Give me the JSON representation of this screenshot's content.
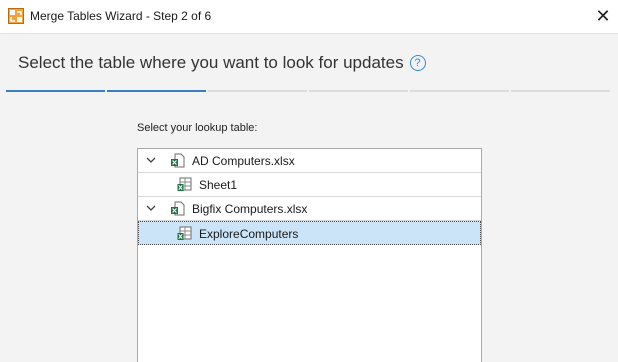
{
  "window": {
    "title": "Merge Tables Wizard - Step 2 of 6"
  },
  "header": {
    "text": "Select the table where you want to look for updates"
  },
  "steps": {
    "total": 6,
    "current": 2
  },
  "lookup": {
    "label": "Select your lookup table:",
    "tree": [
      {
        "label": "AD Computers.xlsx",
        "type": "workbook",
        "expanded": true
      },
      {
        "label": "Sheet1",
        "type": "sheet"
      },
      {
        "label": "Bigfix Computers.xlsx",
        "type": "workbook",
        "expanded": true
      },
      {
        "label": "ExploreComputers",
        "type": "sheet",
        "selected": true
      }
    ]
  },
  "colors": {
    "accent": "#3a7fc4",
    "selection": "#cce4f7",
    "excel_green": "#1e7145"
  }
}
